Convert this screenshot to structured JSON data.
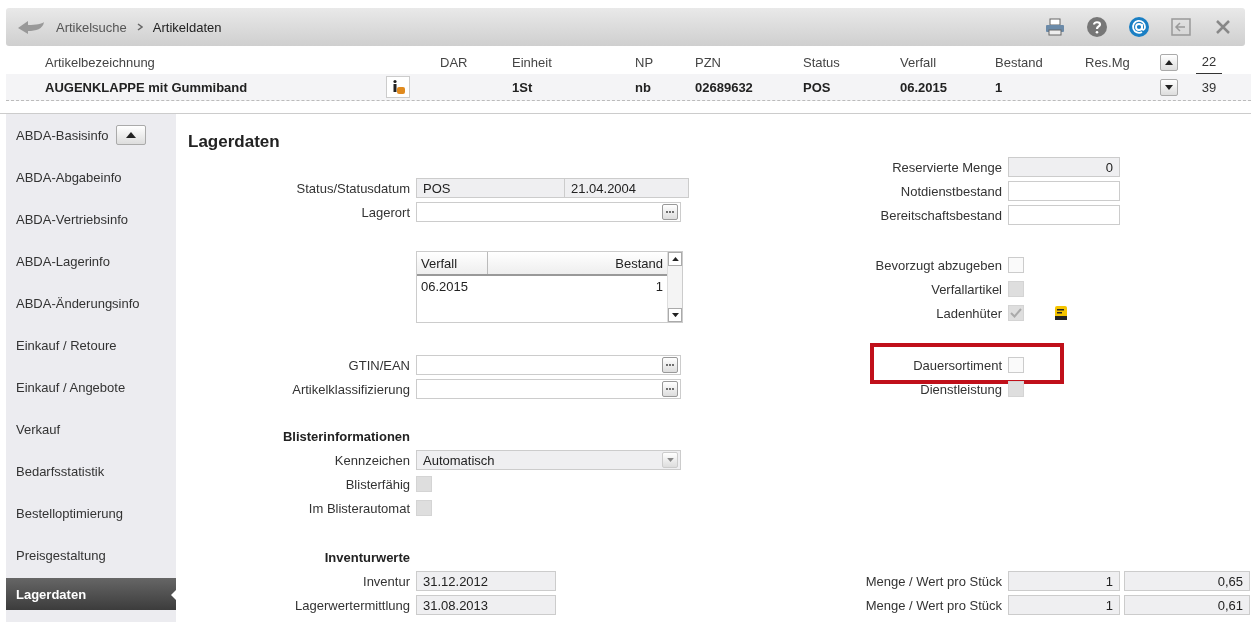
{
  "breadcrumb": [
    {
      "label": "Artikelsuche",
      "selected": false
    },
    {
      "label": "Artikeldaten",
      "selected": true
    }
  ],
  "article": {
    "columns": [
      {
        "header": "Artikelbezeichnung",
        "value": "AUGENKLAPPE mit Gummiband"
      },
      {
        "header": "DAR"
      },
      {
        "header": "Einheit",
        "value": "1St"
      },
      {
        "header": "NP",
        "value": "nb"
      },
      {
        "header": "PZN",
        "value": "02689632"
      },
      {
        "header": "Status",
        "value": "POS"
      },
      {
        "header": "Verfall",
        "value": "06.2015"
      },
      {
        "header": "Bestand",
        "value": "1"
      },
      {
        "header": "Res.Mg"
      }
    ],
    "counter": {
      "current": "22",
      "total": "39"
    }
  },
  "sidebar": {
    "items": [
      {
        "label": "ABDA-Basisinfo",
        "selected": false
      },
      {
        "label": "ABDA-Abgabeinfo",
        "selected": false
      },
      {
        "label": "ABDA-Vertriebsinfo",
        "selected": false
      },
      {
        "label": "ABDA-Lagerinfo",
        "selected": false
      },
      {
        "label": "ABDA-Änderungsinfo",
        "selected": false
      },
      {
        "label": "Einkauf / Retoure",
        "selected": false
      },
      {
        "label": "Einkauf / Angebote",
        "selected": false
      },
      {
        "label": "Verkauf",
        "selected": false
      },
      {
        "label": "Bedarfsstatistik",
        "selected": false
      },
      {
        "label": "Bestelloptimierung",
        "selected": false
      },
      {
        "label": "Preisgestaltung",
        "selected": false
      },
      {
        "label": "Lagerdaten",
        "selected": true
      }
    ]
  },
  "title": "Lagerdaten",
  "left": {
    "status": {
      "label": "Status/Statusdatum",
      "values": [
        "POS",
        "21.04.2004"
      ],
      "disabled": true
    },
    "lagerort": {
      "label": "Lagerort",
      "kind": "lookup",
      "disabled": false
    },
    "batches": {
      "columns": [
        "Verfall",
        "Bestand"
      ],
      "rows": [
        [
          "06.2015",
          "1"
        ]
      ]
    },
    "codes": [
      {
        "label": "GTIN/EAN",
        "kind": "lookup",
        "disabled": false
      },
      {
        "label": "Artikelklassifizierung",
        "kind": "lookup",
        "disabled": false
      }
    ],
    "blister": {
      "heading": "Blisterinformationen",
      "kennzeichen": {
        "label": "Kennzeichen",
        "value": "Automatisch",
        "kind": "dropdown",
        "disabled": true
      },
      "checks": [
        {
          "label": "Blisterfähig",
          "checked": false,
          "disabled": true
        },
        {
          "label": "Im Blisterautomat",
          "checked": false,
          "disabled": true
        }
      ]
    },
    "inventory": {
      "heading": "Inventurwerte",
      "rows": [
        {
          "label": "Inventur",
          "value": "31.12.2012"
        },
        {
          "label": "Lagerwertermittlung",
          "value": "31.08.2013"
        }
      ]
    }
  },
  "right": {
    "quantities": [
      {
        "label": "Reservierte Menge",
        "value": "0",
        "disabled": true
      },
      {
        "label": "Notdienstbestand",
        "disabled": false
      },
      {
        "label": "Bereitschaftsbestand",
        "disabled": false
      }
    ],
    "flags": [
      {
        "label": "Bevorzugt abzugeben",
        "checked": false,
        "disabled": false,
        "highlight": false,
        "note": false
      },
      {
        "label": "Verfallartikel",
        "checked": false,
        "disabled": true,
        "highlight": false,
        "note": false
      },
      {
        "label": "Ladenhüter",
        "checked": true,
        "disabled": true,
        "highlight": false,
        "note": true
      }
    ],
    "flags2": [
      {
        "label": "Dauersortiment",
        "checked": false,
        "disabled": false,
        "highlight": true,
        "note": false
      },
      {
        "label": "Dienstleistung",
        "checked": false,
        "disabled": true,
        "highlight": false,
        "note": false
      }
    ],
    "values": [
      {
        "label": "Menge / Wert pro Stück",
        "quantity": "1",
        "value": "0,65"
      },
      {
        "label": "Menge / Wert pro Stück",
        "quantity": "1",
        "value": "0,61"
      }
    ]
  }
}
